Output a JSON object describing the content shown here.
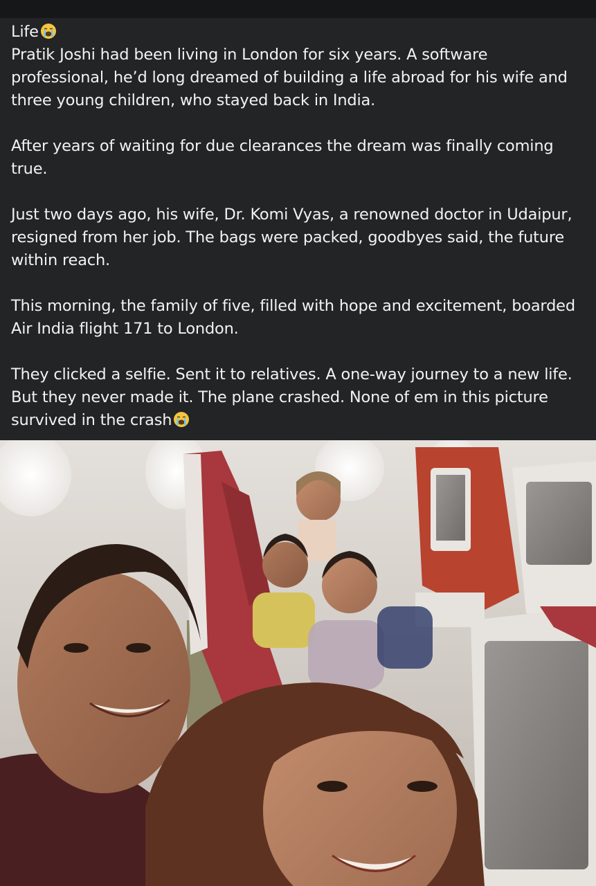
{
  "post": {
    "heading": "Life",
    "heading_emoji": "crying-face-icon",
    "paragraphs": [
      "Pratik Joshi had been living in London for six years. A software professional, he’d long dreamed of building a life abroad for his wife and three young children, who stayed back in India.",
      "After years of waiting for due clearances the dream was finally coming true.",
      "Just two days ago, his wife, Dr. Komi Vyas, a renowned doctor in Udaipur, resigned from her job. The bags were packed, goodbyes said, the future within reach.",
      "This morning, the family of five, filled with hope and excitement, boarded Air India flight 171 to London.",
      "They clicked a selfie. Sent it to relatives. A one-way journey to a new life. But they never made it. The plane crashed. None of em in this picture survived in the crash"
    ],
    "closing_emoji": "crying-face-icon"
  },
  "colors": {
    "background": "#222426",
    "text": "#f2f2f2",
    "seat_red": "#a8383d",
    "cabin_wall": "#d9d4cf"
  }
}
